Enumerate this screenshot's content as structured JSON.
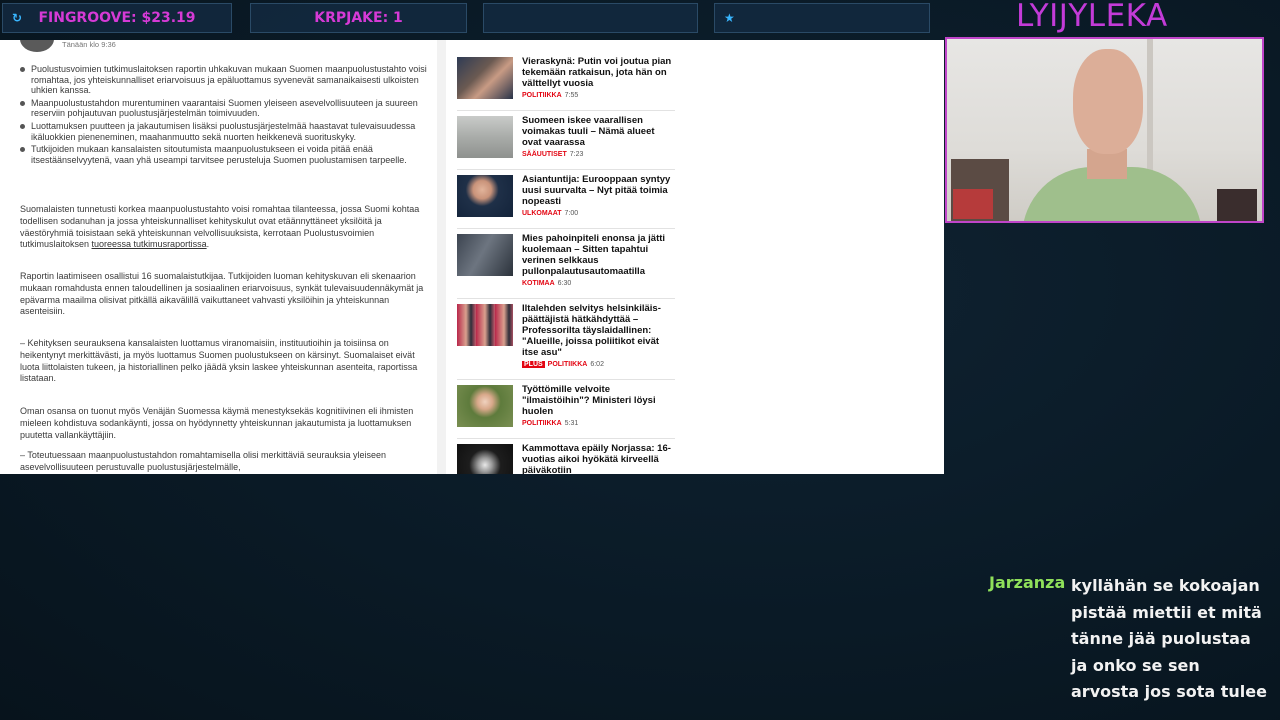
{
  "overlay": {
    "fingroove": {
      "icon": "refresh-icon",
      "text": "FINGROOVE: $23.19"
    },
    "krpjake": {
      "text": "KRPJAKE: 1"
    },
    "empty_box": {
      "text": ""
    },
    "star_box": {
      "icon": "star-icon",
      "text": ""
    },
    "channel_name": "LYIJYLEKA",
    "accent_color": "#c33bd8",
    "icon_color": "#39b6ff"
  },
  "article": {
    "timestamp": "Tänään klo 9:36",
    "bullets": [
      "Puolustusvoimien tutkimuslaitoksen raportin uhkakuvan mukaan Suomen maanpuolustustahto voisi romahtaa, jos yhteiskunnalliset eriarvoisuus ja epäluottamus syvenevät samanaikaisesti ulkoisten uhkien kanssa.",
      "Maanpuolustustahdon murentuminen vaarantaisi Suomen yleiseen asevelvollisuuteen ja suureen reserviin pohjautuvan puolustusjärjestelmän toimivuuden.",
      "Luottamuksen puutteen ja jakautumisen lisäksi puolustusjärjestelmää haastavat tulevaisuudessa ikäluokkien pieneneminen, maahanmuutto sekä nuorten heikkenevä suorituskyky.",
      "Tutkijoiden mukaan kansalaisten sitoutumista maanpuolustukseen ei voida pitää enää itsestäänselvyytenä, vaan yhä useampi tarvitsee perusteluja Suomen puolustamisen tarpeelle."
    ],
    "p1_text": "Suomalaisten tunnetusti korkea maanpuolustustahto voisi romahtaa tilanteessa, jossa Suomi kohtaa todellisen sodanuhan ja jossa yhteiskunnalliset kehityskulut ovat etäännyttäneet yksilöitä ja väestöryhmiä toisistaan sekä yhteiskunnan velvollisuuksista, kerrotaan Puolustusvoimien tutkimuslaitoksen ",
    "p1_link": "tuoreessa tutkimusraportissa",
    "p1_end": ".",
    "p2": "Raportin laatimiseen osallistui 16 suomalaistutkijaa. Tutkijoiden luoman kehityskuvan eli skenaarion mukaan romahdusta ennen taloudellinen ja sosiaalinen eriarvoisuus, synkät tulevaisuudennäkymät ja epävarma maailma olisivat pitkällä aikavälillä vaikuttaneet vahvasti yksilöihin ja yhteiskunnan asenteisiin.",
    "p3": "– Kehityksen seurauksena kansalaisten luottamus viranomaisiin, instituutioihin ja toisiinsa on heikentynyt merkittävästi, ja myös luottamus Suomen puolustukseen on kärsinyt. Suomalaiset eivät luota liittolaisten tukeen, ja historiallinen pelko jäädä yksin laskee yhteiskunnan asenteita, raportissa listataan.",
    "p4": "Oman osansa on tuonut myös Venäjän Suomessa käymä menestyksekäs kognitiivinen eli ihmisten mieleen kohdistuva sodankäynti, jossa on hyödynnetty yhteiskunnan jakautumista ja luottamuksen puutetta vallankäyttäjiin.",
    "p5": "– Toteutuessaan maanpuolustustahdon romahtamisella olisi merkittäviä seurauksia yleiseen asevelvollisuuteen perustuvalle puolustusjärjestelmälle,"
  },
  "news": [
    {
      "headline": "Vieraskynä: Putin voi joutua pian tekemään ratkaisun, jota hän on välttellyt vuosia",
      "category": "POLITIIKKA",
      "time": "7:55",
      "plus": ""
    },
    {
      "headline": "Suomeen iskee vaarallisen voimakas tuuli – Nämä alueet ovat vaarassa",
      "category": "SÄÄUUTISET",
      "time": "7:23",
      "plus": ""
    },
    {
      "headline": "Asiantuntija: Eurooppaan syntyy uusi suurvalta – Nyt pitää toimia nopeasti",
      "category": "ULKOMAAT",
      "time": "7:00",
      "plus": ""
    },
    {
      "headline": "Mies pahoinpiteli enonsa ja jätti kuolemaan – Sitten tapahtui verinen selkkaus pullonpalautusautomaatilla",
      "category": "KOTIMAA",
      "time": "6:30",
      "plus": ""
    },
    {
      "headline": "Iltalehden selvitys helsinkiläis-päättäjistä hätkähdyttää – Professorilta täyslaidallinen: \"Alueille, joissa poliitikot eivät itse asu\"",
      "category": "POLITIIKKA",
      "time": "6:02",
      "plus": "PLUS"
    },
    {
      "headline": "Työttömille velvoite \"ilmaistöihin\"? Ministeri löysi huolen",
      "category": "POLITIIKKA",
      "time": "5:31",
      "plus": ""
    },
    {
      "headline": "Kammottava epäily Norjassa: 16-vuotias aikoi hyökätä kirveellä päiväkotiin",
      "category": "",
      "time": "",
      "plus": ""
    }
  ],
  "chat": {
    "user": "Jarzanza",
    "user_color": "#8fe05a",
    "message": "kyllähän se kokoajan pistää miettii et mitä tänne jää puolustaa ja onko se sen arvosta jos sota tulee"
  }
}
